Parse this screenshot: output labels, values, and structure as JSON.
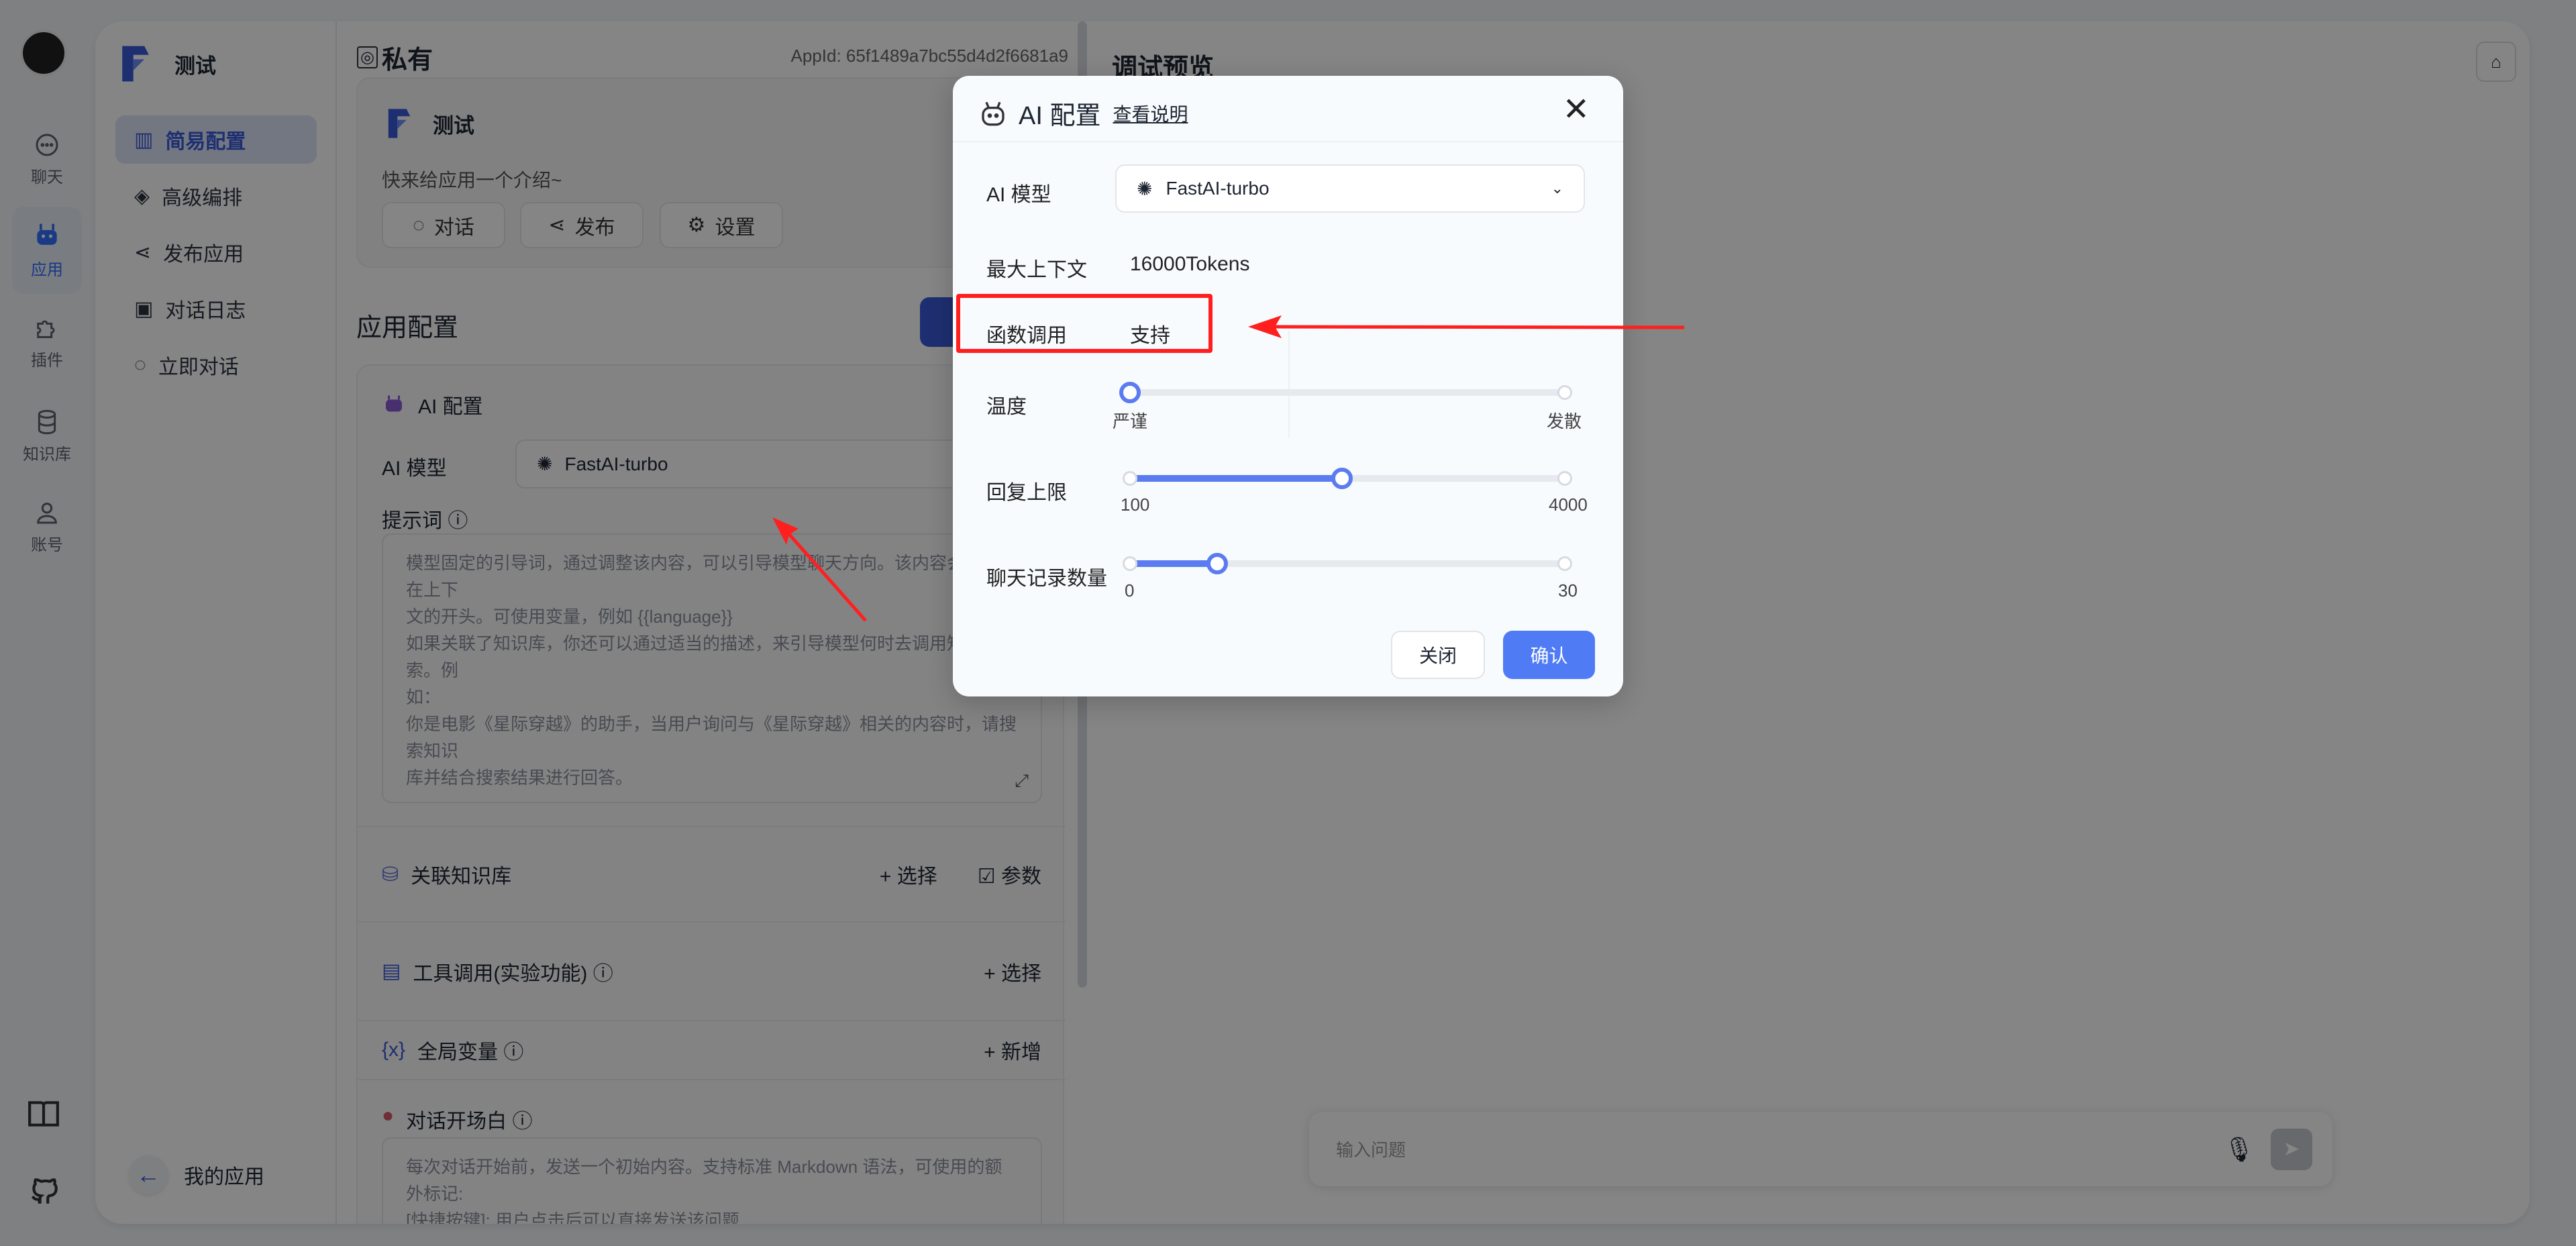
{
  "rail": {
    "items": [
      {
        "label": "聊天",
        "icon": "chat-icon"
      },
      {
        "label": "应用",
        "icon": "robot-icon",
        "active": true
      },
      {
        "label": "插件",
        "icon": "puzzle-icon"
      },
      {
        "label": "知识库",
        "icon": "database-icon"
      },
      {
        "label": "账号",
        "icon": "user-icon"
      }
    ],
    "bottom": [
      "book-icon",
      "github-icon"
    ]
  },
  "app_sidebar": {
    "app_name": "测试",
    "items": [
      {
        "label": "简易配置",
        "active": true
      },
      {
        "label": "高级编排"
      },
      {
        "label": "发布应用"
      },
      {
        "label": "对话日志"
      },
      {
        "label": "立即对话"
      }
    ],
    "back_label": "我的应用"
  },
  "header": {
    "visibility": "私有",
    "app_id": "AppId: 65f1489a7bc55d4d2f6681a9"
  },
  "app_card": {
    "name": "测试",
    "intro": "快来给应用一个介绍~",
    "buttons": [
      "对话",
      "发布",
      "设置"
    ]
  },
  "config": {
    "title": "应用配置",
    "ai": {
      "title": "AI 配置",
      "model_label": "AI 模型",
      "model": "FastAI-turbo",
      "prompt_label": "提示词",
      "prompt_placeholder": [
        "模型固定的引导词，通过调整该内容，可以引导模型聊天方向。该内容会被固定在上下",
        "文的开头。可使用变量，例如 {{language}}",
        "如果关联了知识库，你还可以通过适当的描述，来引导模型何时去调用知识库搜索。例",
        "如：",
        "你是电影《星际穿越》的助手，当用户询问与《星际穿越》相关的内容时，请搜索知识",
        "库并结合搜索结果进行回答。"
      ]
    },
    "dataset": {
      "label": "关联知识库",
      "select": "+ 选择",
      "params": "参数"
    },
    "tools": {
      "label": "工具调用(实验功能)",
      "select": "+ 选择"
    },
    "variables": {
      "label": "全局变量",
      "add": "+ 新增"
    },
    "welcome": {
      "label": "对话开场白",
      "placeholder": [
        "每次对话开始前，发送一个初始内容。支持标准 Markdown 语法，可使用的额外标记:",
        "[快捷按键]: 用户点击后可以直接发送该问题"
      ]
    }
  },
  "preview": {
    "title": "调试预览",
    "input_placeholder": "输入问题"
  },
  "modal": {
    "title": "AI 配置",
    "help_link": "查看说明",
    "model_label": "AI 模型",
    "model": "FastAI-turbo",
    "max_context_label": "最大上下文",
    "max_context": "16000Tokens",
    "function_call_label": "函数调用",
    "function_call": "支持",
    "temperature": {
      "label": "温度",
      "min_label": "严谨",
      "max_label": "发散",
      "value_fraction": 0
    },
    "max_tokens": {
      "label": "回复上限",
      "min": "100",
      "max": "4000",
      "value": 2000
    },
    "history": {
      "label": "聊天记录数量",
      "min": "0",
      "max": "30",
      "value": 6
    },
    "cancel": "关闭",
    "confirm": "确认"
  },
  "colors": {
    "accent": "#3370ff",
    "slider": "#5b7cf0",
    "annotation": "#ff1f1f"
  }
}
